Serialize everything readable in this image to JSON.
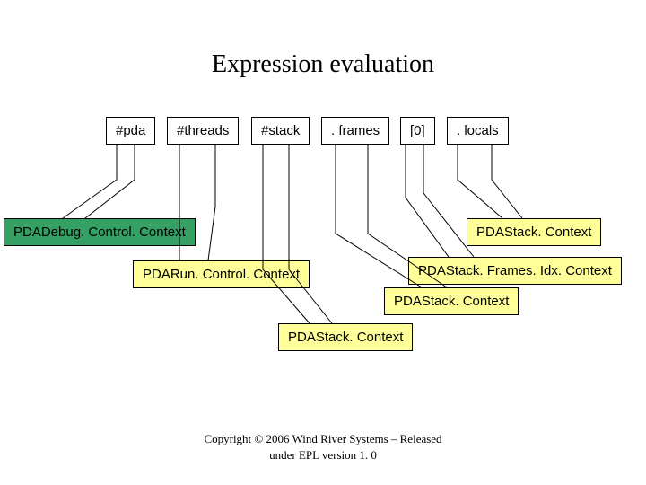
{
  "title": "Expression evaluation",
  "tokens": {
    "pda": "#pda",
    "threads": "#threads",
    "stack": "#stack",
    "frames": ". frames",
    "idx": "[0]",
    "locals": ". locals"
  },
  "contexts": {
    "debug": "PDADebug. Control. Context",
    "run": "PDARun. Control. Context",
    "stack_top": "PDAStack. Context",
    "frames_idx": "PDAStack. Frames. Idx. Context",
    "stack_mid": "PDAStack. Context",
    "stack_bottom": "PDAStack. Context"
  },
  "copyright": {
    "line1": "Copyright © 2006 Wind River Systems – Released",
    "line2": "under EPL version 1. 0"
  }
}
